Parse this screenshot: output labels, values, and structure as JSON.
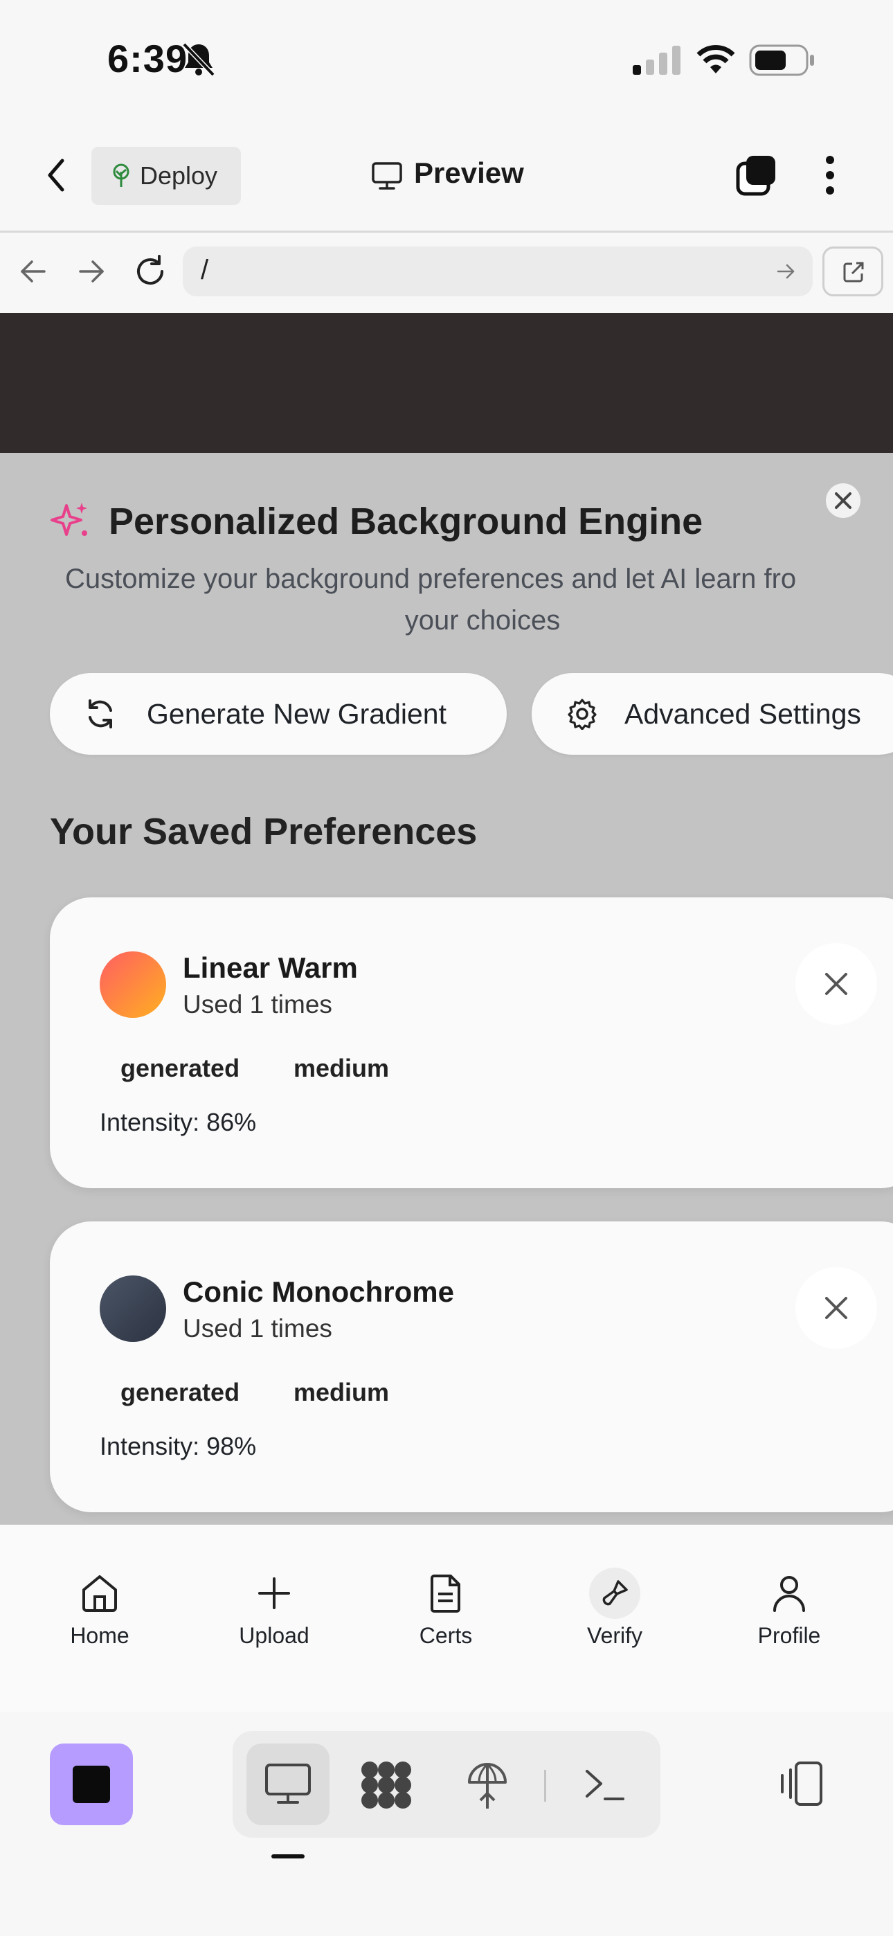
{
  "status_bar": {
    "time": "6:39"
  },
  "header": {
    "deploy_label": "Deploy",
    "title": "Preview"
  },
  "address_bar": {
    "url": "/"
  },
  "engine": {
    "title": "Personalized Background Engine",
    "subtitle_line1": "Customize your background preferences and let AI learn fro",
    "subtitle_line2": "your choices",
    "generate_label": "Generate New Gradient",
    "advanced_label": "Advanced Settings"
  },
  "saved": {
    "heading": "Your Saved Preferences",
    "items": [
      {
        "name": "Linear Warm",
        "used": "Used 1 times",
        "tags": [
          "generated",
          "medium"
        ],
        "intensity": "Intensity: 86%",
        "swatch_from": "#ff5e62",
        "swatch_to": "#ffb020"
      },
      {
        "name": "Conic Monochrome",
        "used": "Used 1 times",
        "tags": [
          "generated",
          "medium"
        ],
        "intensity": "Intensity: 98%",
        "swatch_from": "#4b5566",
        "swatch_to": "#2c3342"
      }
    ]
  },
  "bottom_nav": {
    "items": [
      {
        "label": "Home",
        "icon": "home-icon"
      },
      {
        "label": "Upload",
        "icon": "plus-icon"
      },
      {
        "label": "Certs",
        "icon": "document-icon"
      },
      {
        "label": "Verify",
        "icon": "brush-icon"
      },
      {
        "label": "Profile",
        "icon": "user-icon"
      }
    ]
  },
  "colors": {
    "accent_sparkle": "#e8408a",
    "dock_app": "#b69cff",
    "dark_band": "#322b2b"
  }
}
